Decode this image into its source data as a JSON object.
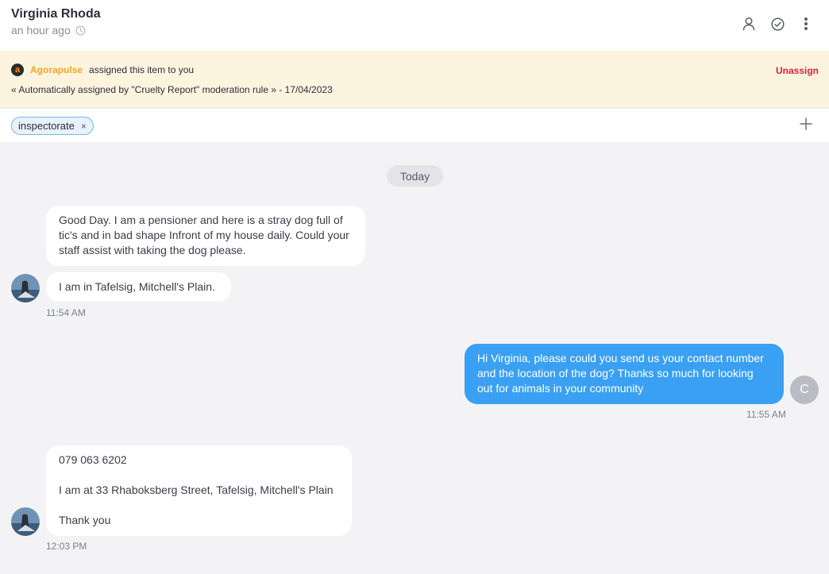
{
  "header": {
    "name": "Virginia Rhoda",
    "time": "an hour ago"
  },
  "banner": {
    "logo_letter": "a",
    "brand": "Agorapulse",
    "assigned_text": "assigned this item to you",
    "auto_text": "« Automatically assigned by \"Cruelty Report\" moderation rule » - 17/04/2023",
    "unassign_label": "Unassign"
  },
  "tags": [
    {
      "label": "inspectorate",
      "remove": "×"
    }
  ],
  "day_separator": "Today",
  "messages": [
    {
      "direction": "in",
      "text": "Good Day. I am a pensioner and here is a stray dog full of tic's and in bad shape Infront of my house daily. Could your staff assist with taking the dog please."
    },
    {
      "direction": "in",
      "text": "I am in Tafelsig, Mitchell's Plain.",
      "time": "11:54 AM"
    },
    {
      "direction": "out",
      "text": "Hi Virginia, please could you send us your contact number and the location of the dog? Thanks so much for looking out for animals in your community",
      "time": "11:55 AM",
      "avatar_letter": "C"
    },
    {
      "direction": "in",
      "lines": [
        "079 063 6202",
        "I am at 33 Rhaboksberg Street, Tafelsig, Mitchell's Plain",
        "Thank you"
      ],
      "time": "12:03 PM"
    }
  ],
  "colors": {
    "outgoing_bubble": "#3aa0f3",
    "banner_bg": "#fdf4df",
    "unassign": "#d6233a",
    "brand": "#f5a623"
  },
  "icons": {
    "clock": "clock-icon",
    "assign": "user-icon",
    "resolve": "check-circle-icon",
    "more": "more-vertical-icon",
    "add_tag": "plus-icon",
    "remove_tag": "close-icon"
  }
}
